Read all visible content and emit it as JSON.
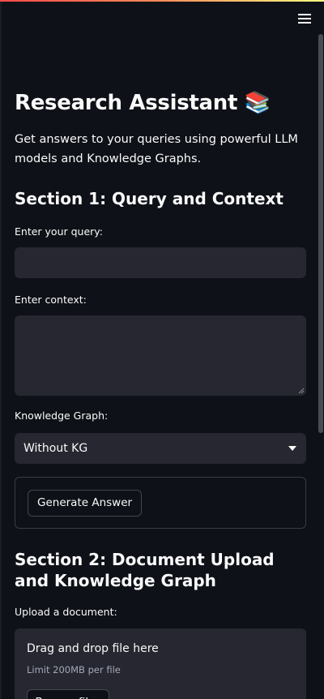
{
  "header": {
    "menu_icon": "hamburger-menu-icon"
  },
  "main": {
    "title": "Research Assistant 📚",
    "subtitle": "Get answers to your queries using powerful LLM models and Knowledge Graphs."
  },
  "section1": {
    "heading": "Section 1: Query and Context",
    "query_label": "Enter your query:",
    "query_value": "",
    "context_label": "Enter context:",
    "context_value": "",
    "kg_label": "Knowledge Graph:",
    "kg_selected": "Without KG",
    "generate_button": "Generate Answer"
  },
  "section2": {
    "heading": "Section 2: Document Upload and Knowledge Graph",
    "upload_label": "Upload a document:",
    "dropzone_title": "Drag and drop file here",
    "dropzone_limit": "Limit 200MB per file",
    "browse_button": "Browse files"
  },
  "colors": {
    "background": "#0e1117",
    "input_background": "#262730",
    "text": "#fafafa",
    "muted_text": "#a3a8b8",
    "accent_red": "#ff4b4b"
  }
}
